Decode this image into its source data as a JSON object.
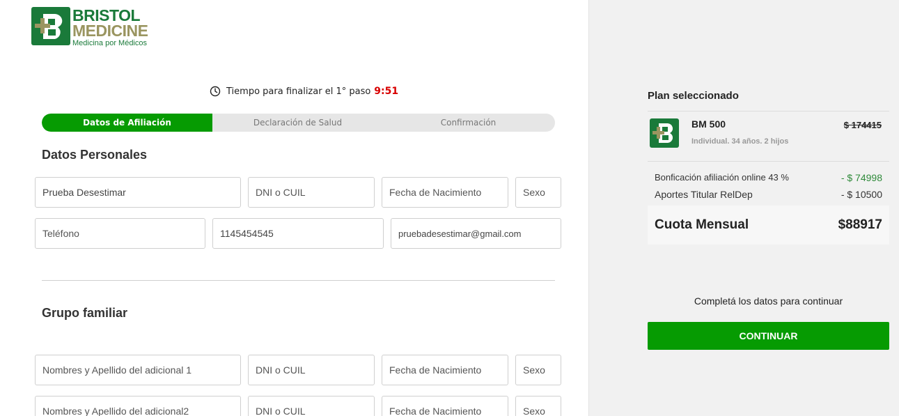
{
  "brand": {
    "line1": "BRISTOL",
    "line2": "MEDICINE",
    "tagline": "Medicina por Médicos",
    "primary_color": "#1a7a3a",
    "secondary_color": "#9a9560"
  },
  "timer": {
    "label": "Tiempo para finalizar el 1° paso",
    "value": "9:51",
    "icon": "clock-icon"
  },
  "steps": [
    {
      "label": "Datos de Afiliación",
      "active": true
    },
    {
      "label": "Declaración de Salud",
      "active": false
    },
    {
      "label": "Confirmación",
      "active": false
    }
  ],
  "personal": {
    "title": "Datos Personales",
    "name": {
      "value": "Prueba Desestimar"
    },
    "dni": {
      "placeholder": "DNI o CUIL"
    },
    "birth": {
      "placeholder": "Fecha de Nacimiento"
    },
    "sex": {
      "placeholder": "Sexo"
    },
    "phone": {
      "placeholder": "Teléfono"
    },
    "phone2": {
      "value": "1145454545"
    },
    "email": {
      "value": "pruebadesestimar@gmail.com"
    }
  },
  "family": {
    "title": "Grupo familiar",
    "members": [
      {
        "name_placeholder": "Nombres y Apellido del adicional 1",
        "dni_placeholder": "DNI o CUIL",
        "birth_placeholder": "Fecha de Nacimiento",
        "sex_placeholder": "Sexo"
      },
      {
        "name_placeholder": "Nombres y Apellido del adicional2",
        "dni_placeholder": "DNI o CUIL",
        "birth_placeholder": "Fecha de Nacimiento",
        "sex_placeholder": "Sexo"
      }
    ]
  },
  "plan": {
    "title": "Plan seleccionado",
    "name": "BM 500",
    "description": "Individual. 34 años. 2 hijos",
    "original_price": "$ 174415",
    "discounts": [
      {
        "label": "Bonficación afiliación online 43 %",
        "amount": "- $ 74998"
      },
      {
        "label": "Aportes Titular RelDep",
        "amount": "- $ 10500"
      }
    ],
    "total_label": "Cuota Mensual",
    "total_amount": "$88917",
    "hint": "Completá los datos para continuar",
    "continue_label": "CONTINUAR",
    "accent_color": "#069b02"
  }
}
